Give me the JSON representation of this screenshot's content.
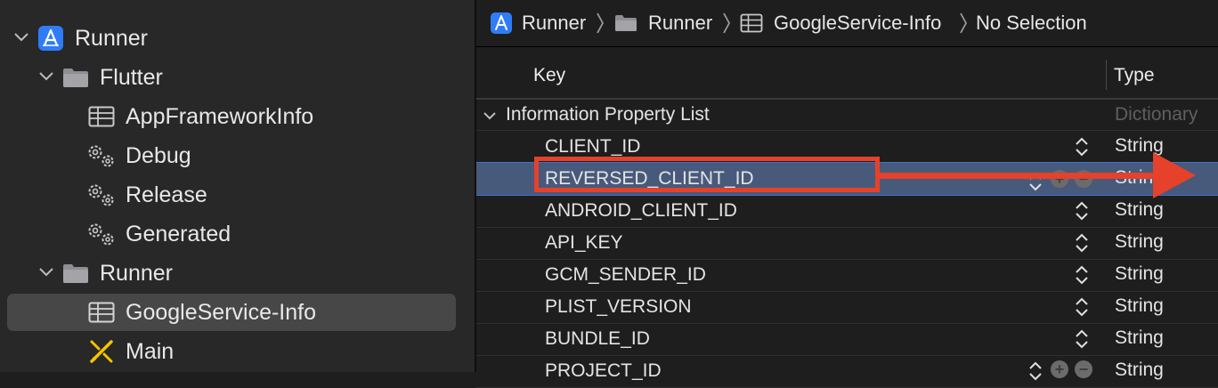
{
  "navigator": {
    "items": [
      {
        "label": "Runner",
        "icon": "xcode-project-icon",
        "disclosure": "expanded"
      },
      {
        "label": "Flutter",
        "icon": "folder-icon",
        "disclosure": "expanded"
      },
      {
        "label": "AppFrameworkInfo",
        "icon": "plist-table-icon"
      },
      {
        "label": "Debug",
        "icon": "gear-settings-icon"
      },
      {
        "label": "Release",
        "icon": "gear-settings-icon"
      },
      {
        "label": "Generated",
        "icon": "gear-settings-icon"
      },
      {
        "label": "Runner",
        "icon": "folder-icon",
        "disclosure": "expanded"
      },
      {
        "label": "GoogleService-Info",
        "icon": "plist-table-icon",
        "selected": true
      },
      {
        "label": "Main",
        "icon": "storyboard-icon"
      }
    ]
  },
  "jumpbar": {
    "crumbs": [
      "Runner",
      "Runner",
      "GoogleService-Info",
      "No Selection"
    ]
  },
  "plist": {
    "headers": {
      "key": "Key",
      "type": "Type"
    },
    "root": {
      "key": "Information Property List",
      "type": "Dictionary"
    },
    "rows": [
      {
        "key": "CLIENT_ID",
        "type": "String"
      },
      {
        "key": "REVERSED_CLIENT_ID",
        "type": "Strin",
        "selected": true
      },
      {
        "key": "ANDROID_CLIENT_ID",
        "type": "String"
      },
      {
        "key": "API_KEY",
        "type": "String"
      },
      {
        "key": "GCM_SENDER_ID",
        "type": "String"
      },
      {
        "key": "PLIST_VERSION",
        "type": "String"
      },
      {
        "key": "BUNDLE_ID",
        "type": "String"
      },
      {
        "key": "PROJECT_ID",
        "type": "String"
      }
    ]
  },
  "colors": {
    "annotation": "#e5412b",
    "selection_row": "#485a7b",
    "project_icon": "#2f7cf6",
    "storyboard_icon": "#f5c400"
  }
}
